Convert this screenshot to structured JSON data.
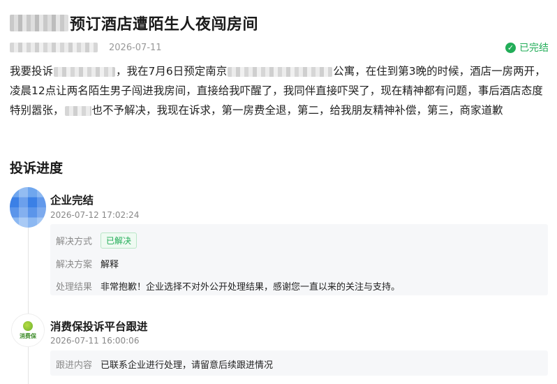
{
  "header": {
    "title": "预订酒店遭陌生人夜闯房间",
    "date": "2026-07-11",
    "status_label": "已完结",
    "status_color": "#22ad58"
  },
  "complaint": {
    "seg1": "我要投诉",
    "seg2": "，我在7月6日预定南京",
    "seg3": "公寓，在住到第3晚的时候，酒店一房两开，凌晨12点让两名陌生男子闯进我房间，直接给我吓醒了，我同伴直接吓哭了，现在精神都有问题，事后酒店态度特别嚣张，",
    "seg4": "也不予解决，我现在诉求，第一房费全退，第二，给我朋友精神补偿，第三，商家道歉"
  },
  "progress": {
    "section_title": "投诉进度",
    "events": [
      {
        "title": "企业完结",
        "time": "2026-07-12 17:02:24",
        "rows": [
          {
            "label": "解决方式",
            "badge": "已解决"
          },
          {
            "label": "解决方案",
            "value": "解释"
          },
          {
            "label": "处理结果",
            "value": "非常抱歉！企业选择不对外公开处理结果，感谢您一直以来的关注与支持。"
          }
        ]
      },
      {
        "title": "消费保投诉平台跟进",
        "time": "2026-07-11 16:00:06",
        "avatar_text": "消费保",
        "rows": [
          {
            "label": "跟进内容",
            "value": "已联系企业进行处理，请留意后续跟进情况"
          }
        ]
      }
    ]
  }
}
